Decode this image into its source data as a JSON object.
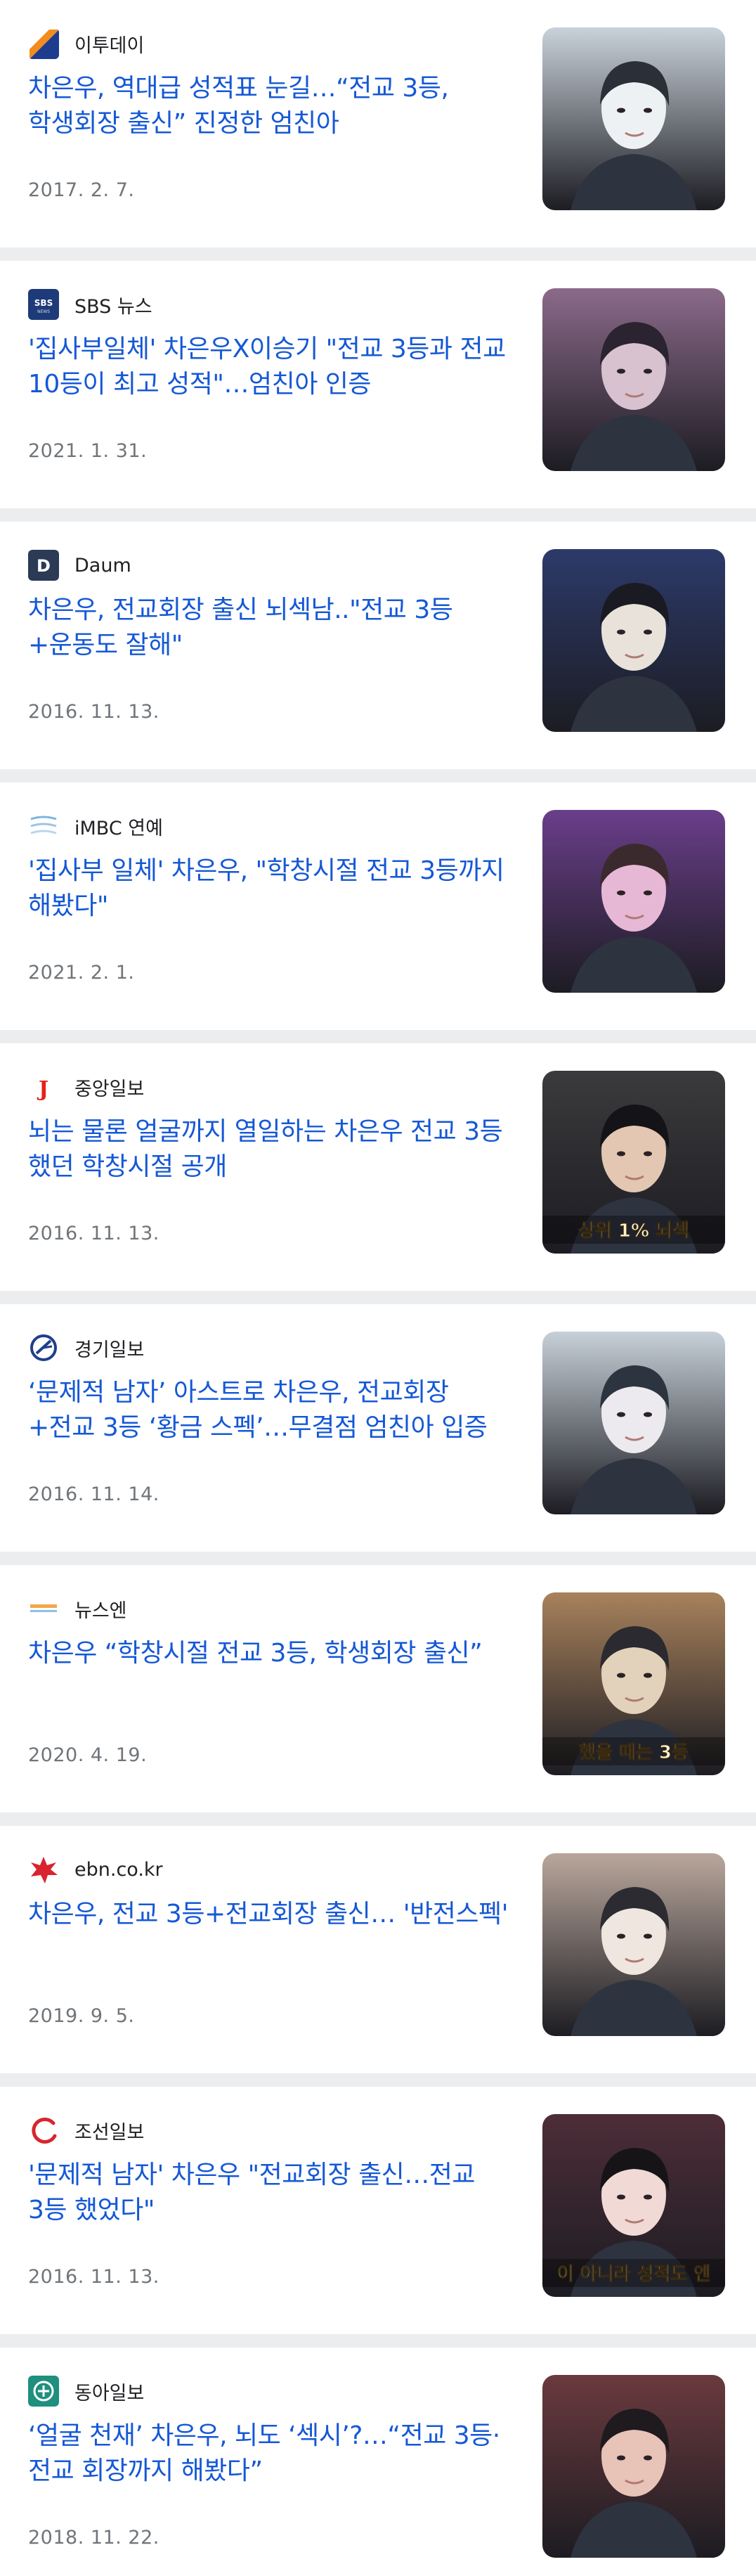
{
  "articles": [
    {
      "source": "이투데이",
      "logo_icon": "etoday-logo-icon",
      "title": "차은우, 역대급 성적표 눈길…“전교 3등, 학생회장 출신” 진정한 엄친아",
      "date": "2017. 2. 7.",
      "thumb_caption": "",
      "thumb_colors": [
        "#c9d2da",
        "#eef1f4",
        "#2a2f38"
      ]
    },
    {
      "source": "SBS 뉴스",
      "logo_icon": "sbs-logo-icon",
      "title": "'집사부일체' 차은우X이승기 \"전교 3등과 전교 10등이 최고 성적\"…엄친아 인증",
      "date": "2021. 1. 31.",
      "thumb_caption": "",
      "thumb_colors": [
        "#8b6a8a",
        "#d8c2d0",
        "#2b2430"
      ]
    },
    {
      "source": "Daum",
      "logo_icon": "daum-logo-icon",
      "title": "차은우, 전교회장 출신 뇌섹남..\"전교 3등+운동도 잘해\"",
      "date": "2016. 11. 13.",
      "thumb_caption": "",
      "thumb_colors": [
        "#2d3a6a",
        "#e8e2da",
        "#1a1a22"
      ]
    },
    {
      "source": "iMBC 연예",
      "logo_icon": "imbc-logo-icon",
      "title": "'집사부 일체' 차은우, \"학창시절 전교 3등까지 해봤다\"",
      "date": "2021. 2. 1.",
      "thumb_caption": "",
      "thumb_colors": [
        "#6a3e8a",
        "#e7b8d6",
        "#3a2a2e"
      ]
    },
    {
      "source": "중앙일보",
      "logo_icon": "joongang-logo-icon",
      "title": "뇌는 물론 얼굴까지 열일하는 차은우 전교 3등 했던 학창시절 공개",
      "date": "2016. 11. 13.",
      "thumb_caption": "상위 1% 뇌섹",
      "thumb_colors": [
        "#3b3a3c",
        "#e3c7b3",
        "#141418"
      ]
    },
    {
      "source": "경기일보",
      "logo_icon": "kyeonggi-logo-icon",
      "title": "‘문제적 남자’ 아스트로 차은우, 전교회장+전교 3등 ‘황금 스펙’…무결점 엄친아 입증",
      "date": "2016. 11. 14.",
      "thumb_caption": "",
      "thumb_colors": [
        "#c7d0d8",
        "#ece9ef",
        "#2c3440"
      ]
    },
    {
      "source": "뉴스엔",
      "logo_icon": "newsen-logo-icon",
      "title": "차은우 “학창시절 전교 3등, 학생회장 출신”",
      "date": "2020. 4. 19.",
      "thumb_caption": "했을 때는 3등",
      "thumb_colors": [
        "#a8825c",
        "#e2d2bb",
        "#2a2a30"
      ]
    },
    {
      "source": "ebn.co.kr",
      "logo_icon": "ebn-logo-icon",
      "title": "차은우, 전교 3등+전교회장 출신… '반전스펙'",
      "date": "2019. 9. 5.",
      "thumb_caption": "",
      "thumb_colors": [
        "#b9a79c",
        "#efe6df",
        "#2b2b31"
      ]
    },
    {
      "source": "조선일보",
      "logo_icon": "chosun-logo-icon",
      "title": "'문제적 남자' 차은우 \"전교회장 출신…전교 3등 했었다\"",
      "date": "2016. 11. 13.",
      "thumb_caption": "이 아니라 성적도 엔",
      "thumb_colors": [
        "#4d2d38",
        "#f1d9d6",
        "#161416"
      ]
    },
    {
      "source": "동아일보",
      "logo_icon": "donga-logo-icon",
      "title": "‘얼굴 천재’ 차은우, 뇌도 ‘섹시’?…“전교 3등·전교 회장까지 해봤다”",
      "date": "2018. 11. 22.",
      "thumb_caption": "",
      "thumb_colors": [
        "#6a3a3e",
        "#e8c3b8",
        "#1e1a1e"
      ]
    }
  ]
}
